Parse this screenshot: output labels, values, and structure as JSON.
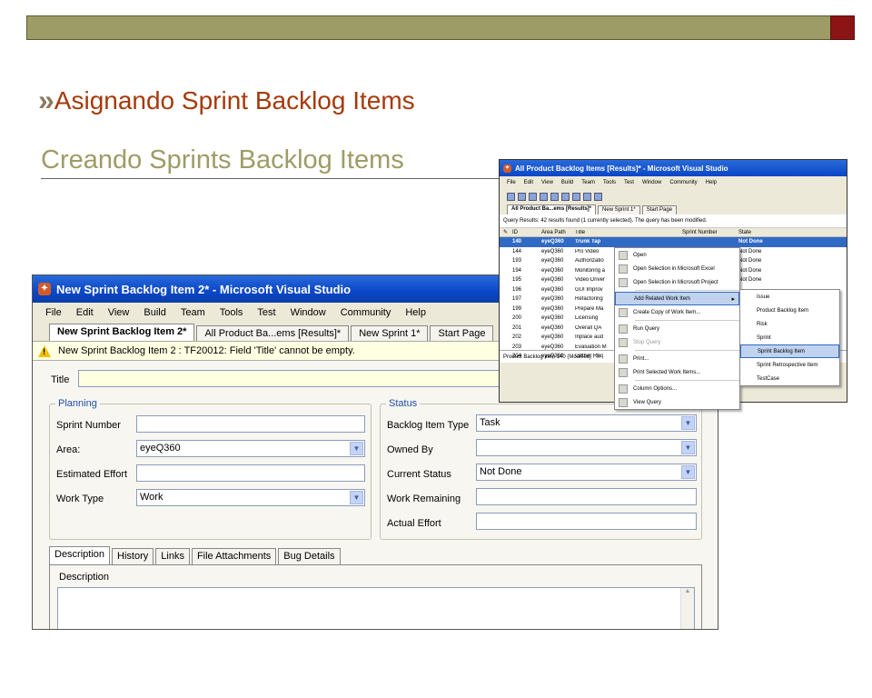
{
  "slide": {
    "title": "Asignando Sprint Backlog Items",
    "subtitle": "Creando Sprints Backlog Items",
    "title_bullet": "»",
    "accent_colors": {
      "title": "#a63a0b",
      "bar": "#9e9c66",
      "bar_end": "#8b1414"
    }
  },
  "main_window": {
    "title": "New Sprint Backlog Item 2* - Microsoft Visual Studio",
    "menu": [
      "File",
      "Edit",
      "View",
      "Build",
      "Team",
      "Tools",
      "Test",
      "Window",
      "Community",
      "Help"
    ],
    "tabs": [
      "New Sprint Backlog Item 2*",
      "All Product Ba...ems [Results]*",
      "New Sprint 1*",
      "Start Page"
    ],
    "warning": "New Sprint Backlog Item 2 : TF20012: Field 'Title' cannot be empty.",
    "title_label": "Title",
    "title_value": "",
    "planning": {
      "label": "Planning",
      "sprint_number_label": "Sprint Number",
      "sprint_number_value": "",
      "area_label": "Area:",
      "area_value": "eyeQ360",
      "estimated_effort_label": "Estimated Effort",
      "estimated_effort_value": "",
      "work_type_label": "Work Type",
      "work_type_value": "Work"
    },
    "status": {
      "label": "Status",
      "backlog_item_type_label": "Backlog Item Type",
      "backlog_item_type_value": "Task",
      "owned_by_label": "Owned By",
      "owned_by_value": "",
      "current_status_label": "Current Status",
      "current_status_value": "Not Done",
      "work_remaining_label": "Work Remaining",
      "work_remaining_value": "",
      "actual_effort_label": "Actual Effort",
      "actual_effort_value": ""
    },
    "bottom_tabs": [
      "Description",
      "History",
      "Links",
      "File Attachments",
      "Bug Details"
    ],
    "description_label": "Description"
  },
  "query_window": {
    "title": "All Product Backlog Items [Results]* - Microsoft Visual Studio",
    "menu": [
      "File",
      "Edit",
      "View",
      "Build",
      "Team",
      "Tools",
      "Test",
      "Window",
      "Community",
      "Help"
    ],
    "tabs": [
      "All Product Ba...ems [Results]*",
      "New Sprint 1*",
      "Start Page"
    ],
    "query_info": "Query Results: 42 results found (1 currently selected). The query has been modified.",
    "columns": [
      "ID",
      "Area Path",
      "Title",
      "Sprint Number",
      "State"
    ],
    "rows": [
      {
        "id": "140",
        "area": "eyeQ360",
        "title": "Trunk Tap",
        "sprint": "",
        "state": "Not Done",
        "selected": true
      },
      {
        "id": "144",
        "area": "eyeQ360",
        "title": "Pro Video",
        "sprint": "",
        "state": "Not Done"
      },
      {
        "id": "193",
        "area": "eyeQ360",
        "title": "Authorizatio",
        "sprint": "",
        "state": "Not Done"
      },
      {
        "id": "194",
        "area": "eyeQ360",
        "title": "Monitoring a",
        "sprint": "",
        "state": "Not Done"
      },
      {
        "id": "195",
        "area": "eyeQ360",
        "title": "Video Driver",
        "sprint": "",
        "state": "Not Done"
      },
      {
        "id": "196",
        "area": "eyeQ360",
        "title": "GUI Improv",
        "sprint": "",
        "state": ""
      },
      {
        "id": "197",
        "area": "eyeQ360",
        "title": "Refactoring",
        "sprint": "",
        "state": ""
      },
      {
        "id": "199",
        "area": "eyeQ360",
        "title": "Prepare Ma",
        "sprint": "",
        "state": ""
      },
      {
        "id": "200",
        "area": "eyeQ360",
        "title": "Licensing",
        "sprint": "",
        "state": ""
      },
      {
        "id": "201",
        "area": "eyeQ360",
        "title": "Overall QA",
        "sprint": "",
        "state": ""
      },
      {
        "id": "202",
        "area": "eyeQ360",
        "title": "Inplace aud",
        "sprint": "",
        "state": ""
      },
      {
        "id": "203",
        "area": "eyeQ360",
        "title": "Evaluation M",
        "sprint": "",
        "state": ""
      },
      {
        "id": "204",
        "area": "eyeQ360",
        "title": "Gather Req",
        "sprint": "",
        "state": ""
      }
    ],
    "work_item_strip": "Product Backlog Item 140 (Modified) : Tr"
  },
  "context_menu": {
    "items": [
      {
        "label": "Open",
        "icon": "open-icon"
      },
      {
        "label": "Open Selection in Microsoft Excel",
        "icon": "excel-icon"
      },
      {
        "label": "Open Selection in Microsoft Project",
        "icon": "project-icon"
      },
      {
        "label": "Add Related Work Item",
        "icon": "",
        "highlighted": true,
        "submenu": true
      },
      {
        "label": "Create Copy of Work Item...",
        "icon": "copy-icon"
      },
      {
        "label": "Run Query",
        "icon": "run-query-icon"
      },
      {
        "label": "Stop Query",
        "icon": "stop-query-icon",
        "disabled": true
      },
      {
        "label": "Print...",
        "icon": "print-icon"
      },
      {
        "label": "Print Selected Work Items...",
        "icon": "print-selected-icon"
      },
      {
        "label": "Column Options...",
        "icon": "column-options-icon"
      },
      {
        "label": "View Query",
        "icon": "view-query-icon"
      }
    ]
  },
  "submenu": {
    "items": [
      "Issue",
      "Product Backlog Item",
      "Risk",
      "Sprint",
      "Sprint Backlog Item",
      "Sprint Retrospective Item",
      "TestCase"
    ],
    "highlighted": "Sprint Backlog Item"
  }
}
